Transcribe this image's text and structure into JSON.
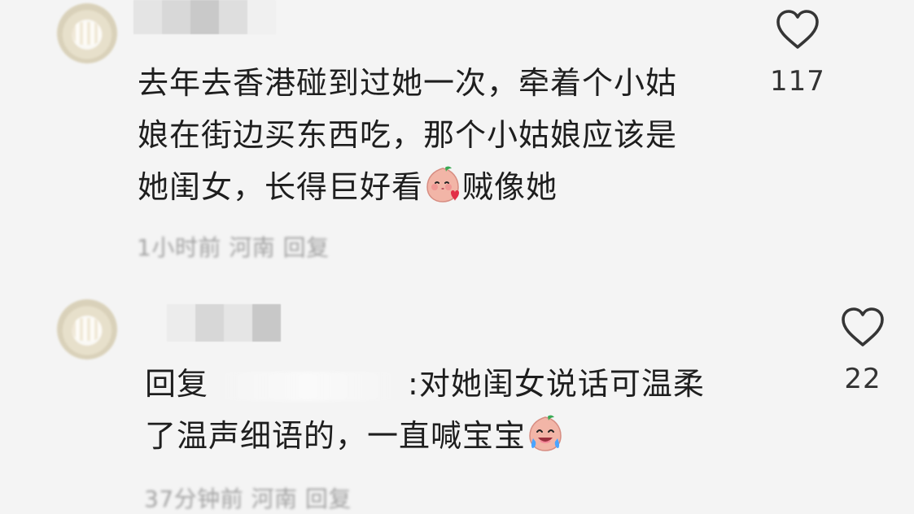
{
  "comments": [
    {
      "text_parts": [
        "去年去香港碰到过她一次，牵着个小姑\n娘在街边买东西吃，那个小姑娘应该是\n她闺女，长得巨好看",
        "贼像她"
      ],
      "emoji_name": "blush-kiss-emoji",
      "meta": "1小时前 河南 回复",
      "likes": "117"
    },
    {
      "reply_prefix": "回复",
      "text_parts": [
        ":对她闺女说话可温柔\n了温声细语的，一直喊宝宝"
      ],
      "emoji_name": "laughing-tears-emoji",
      "meta": "37分钟前 河南 回复",
      "likes": "22"
    }
  ],
  "colors": {
    "background": "#f4f4f4",
    "text": "#1e1e1e",
    "muted": "#8c8c8c"
  }
}
